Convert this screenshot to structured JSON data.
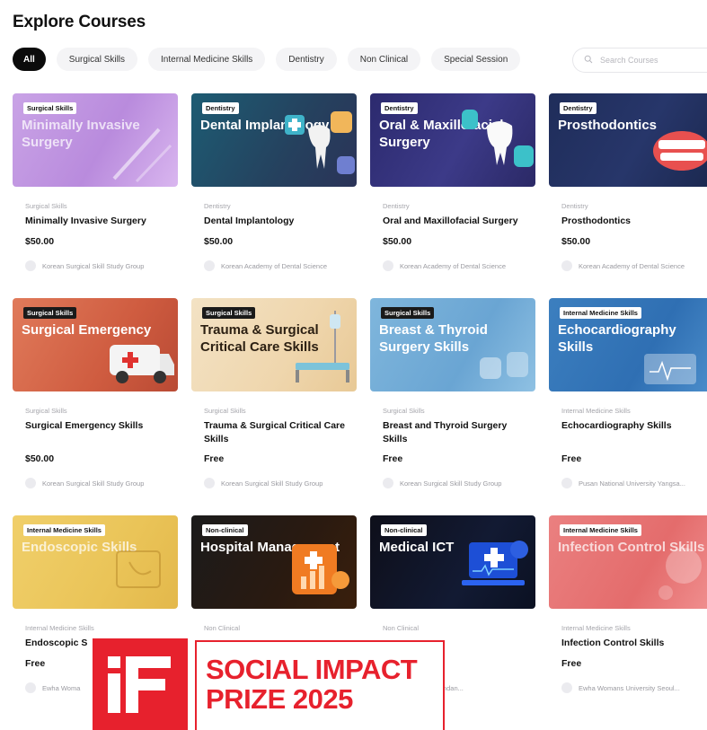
{
  "page": {
    "title": "Explore Courses"
  },
  "filters": [
    "All",
    "Surgical Skills",
    "Internal Medicine Skills",
    "Dentistry",
    "Non Clinical",
    "Special Session"
  ],
  "active_filter": "All",
  "search": {
    "placeholder": "Search Courses"
  },
  "colors": {
    "accent_black": "#0b0b0b",
    "award_red": "#e7212d"
  },
  "courses": [
    {
      "tag": "Surgical Skills",
      "banner": "Minimally Invasive Surgery",
      "category": "Surgical Skills",
      "title": "Minimally Invasive Surgery",
      "price": "$50.00",
      "instructor": "Korean Surgical Skill Study Group"
    },
    {
      "tag": "Dentistry",
      "banner": "Dental Implantology",
      "category": "Dentistry",
      "title": "Dental Implantology",
      "price": "$50.00",
      "instructor": "Korean Academy of Dental Science"
    },
    {
      "tag": "Dentistry",
      "banner": "Oral & Maxillofacial Surgery",
      "category": "Dentistry",
      "title": "Oral and Maxillofacial Surgery",
      "price": "$50.00",
      "instructor": "Korean Academy of Dental Science"
    },
    {
      "tag": "Dentistry",
      "banner": "Prosthodontics",
      "category": "Dentistry",
      "title": "Prosthodontics",
      "price": "$50.00",
      "instructor": "Korean Academy of Dental Science"
    },
    {
      "tag": "Surgical Skills",
      "banner": "Surgical Emergency",
      "category": "Surgical Skills",
      "title": "Surgical Emergency Skills",
      "price": "$50.00",
      "instructor": "Korean Surgical Skill Study Group"
    },
    {
      "tag": "Surgical Skills",
      "banner": "Trauma & Surgical Critical Care Skills",
      "category": "Surgical Skills",
      "title": "Trauma & Surgical Critical Care Skills",
      "price": "Free",
      "instructor": "Korean Surgical Skill Study Group"
    },
    {
      "tag": "Surgical Skills",
      "banner": "Breast & Thyroid Surgery Skills",
      "category": "Surgical Skills",
      "title": "Breast and Thyroid Surgery Skills",
      "price": "Free",
      "instructor": "Korean Surgical Skill Study Group"
    },
    {
      "tag": "Internal Medicine Skills",
      "banner": "Echocardiography Skills",
      "category": "Internal Medicine Skills",
      "title": "Echocardiography Skills",
      "price": "Free",
      "instructor": "Pusan National University Yangsa..."
    },
    {
      "tag": "Internal Medicine Skills",
      "banner": "Endoscopic Skills",
      "category": "Internal Medicine Skills",
      "title": "Endoscopic S",
      "price": "Free",
      "instructor": "Ewha Woma"
    },
    {
      "tag": "Non-clinical",
      "banner": "Hospital Management",
      "category": "Non Clinical",
      "title": "",
      "price": "",
      "instructor": ""
    },
    {
      "tag": "Non-clinical",
      "banner": "Medical ICT",
      "category": "Non Clinical",
      "title": "",
      "price": "",
      "instructor": "l University Bundan..."
    },
    {
      "tag": "Internal Medicine Skills",
      "banner": "Infection Control Skills",
      "category": "Internal Medicine Skills",
      "title": "Infection Control Skills",
      "price": "Free",
      "instructor": "Ewha Womans University Seoul..."
    }
  ],
  "award": {
    "logo_text": "iF",
    "line1": "SOCIAL IMPACT",
    "line2": "PRIZE 2025"
  }
}
